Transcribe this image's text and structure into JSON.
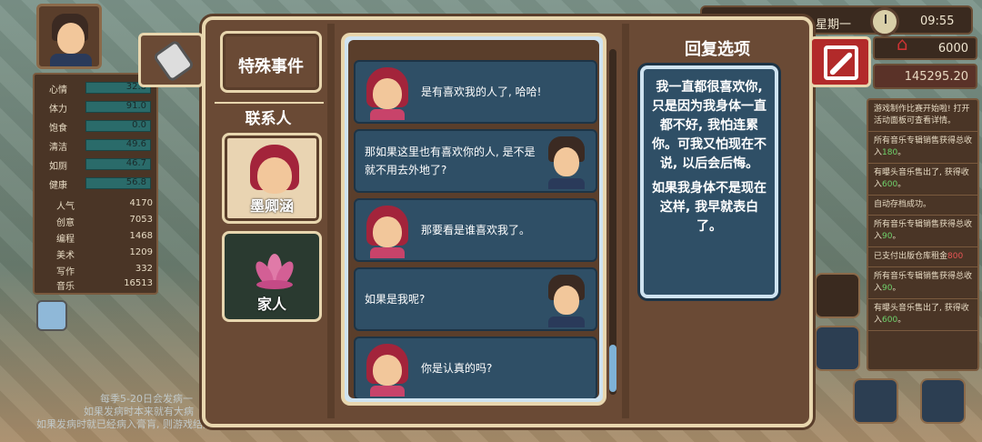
{
  "hud": {
    "day": "星期一",
    "time": "09:55",
    "house_value": "6000",
    "money": "145295.20"
  },
  "stats": {
    "bars": [
      {
        "label": "心情",
        "value": "32.8"
      },
      {
        "label": "体力",
        "value": "91.0"
      },
      {
        "label": "饱食",
        "value": "0.0"
      },
      {
        "label": "清洁",
        "value": "49.6"
      },
      {
        "label": "如厕",
        "value": "46.7"
      },
      {
        "label": "健康",
        "value": "56.8"
      }
    ],
    "numbers": [
      {
        "label": "人气",
        "value": "4170"
      },
      {
        "label": "创意",
        "value": "7053"
      },
      {
        "label": "编程",
        "value": "1468"
      },
      {
        "label": "美术",
        "value": "1209"
      },
      {
        "label": "写作",
        "value": "332"
      },
      {
        "label": "音乐",
        "value": "16513"
      }
    ]
  },
  "bottom_note": {
    "line1": "每季5-20日会发病一",
    "line2": "如果发病时本来就有大病",
    "line3": "如果发病时就已经病入膏肓, 则游戏结束。若生病请及时就医治疗。"
  },
  "log": [
    {
      "text": "游戏制作比赛开始啦! 打开活动面板可查看详情。"
    },
    {
      "text": "所有音乐专辑销售获得总收入",
      "amount": "180",
      "suffix": "。"
    },
    {
      "text": "有曝头音乐售出了, 获得收入",
      "amount": "600",
      "suffix": "。"
    },
    {
      "text": "自动存档成功。"
    },
    {
      "text": "所有音乐专辑销售获得总收入",
      "amount": "90",
      "suffix": "。"
    },
    {
      "text": "已支付出版仓库租金",
      "amount_red": "800",
      "suffix": ""
    },
    {
      "text": "所有音乐专辑销售获得总收入",
      "amount": "90",
      "suffix": "。"
    },
    {
      "text": "有曝头音乐售出了, 获得收入",
      "amount": "600",
      "suffix": "。"
    }
  ],
  "dialog": {
    "special_events_label": "特殊事件",
    "contacts_label": "联系人",
    "contacts": [
      {
        "name": "墨卿涵",
        "selected": true
      },
      {
        "name": "家人",
        "selected": false
      }
    ],
    "messages": [
      {
        "from": "her",
        "text": "是有喜欢我的人了, 哈哈!"
      },
      {
        "from": "me",
        "text": "那如果这里也有喜欢你的人, 是不是就不用去外地了?"
      },
      {
        "from": "her",
        "text": "那要看是谁喜欢我了。"
      },
      {
        "from": "me",
        "text": "如果是我呢?"
      },
      {
        "from": "her",
        "text": "你是认真的吗?"
      }
    ],
    "reply_title": "回复选项",
    "reply_option_p1": "我一直都很喜欢你, 只是因为我身体一直都不好, 我怕连累你。可我又怕现在不说, 以后会后悔。",
    "reply_option_p2": "如果我身体不是现在这样, 我早就表白了。"
  }
}
